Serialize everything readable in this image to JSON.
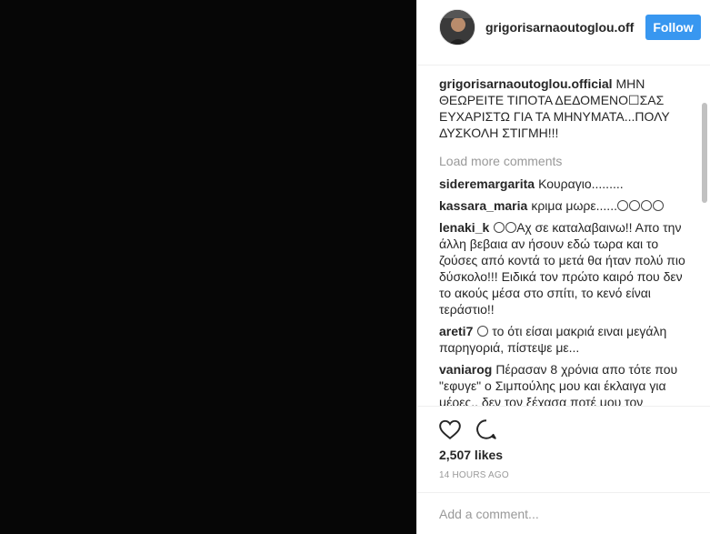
{
  "post": {
    "username": "grigorisarnaoutoglou.official",
    "username_short": "grigorisarnaoutoglou.off",
    "follow_label": "Follow",
    "caption": "ΜΗΝ ΘΕΩΡΕΙΤΕ ΤΙΠΟΤΑ ΔΕΔΟΜΕΝΟ☐ΣΑΣ ΕΥΧΑΡΙΣΤΩ ΓΙΑ ΤΑ ΜΗΝΥΜΑΤΑ...ΠΟΛΥ ΔΥΣΚΟΛΗ ΣΤΙΓΜΗ!!!",
    "load_more": "Load more comments",
    "likes": "2,507 likes",
    "time": "14 HOURS AGO",
    "add_comment_placeholder": "Add a comment..."
  },
  "comments": [
    {
      "user": "sideremargarita",
      "text": "Κουραγιο........."
    },
    {
      "user": "kassara_maria",
      "text": "κριμα μωρε......",
      "emoji_count": 4
    },
    {
      "user": "lenaki_k",
      "text": "Αχ σε καταλαβαινω!! Απο την άλλη βεβαια αν ήσουν εδώ τωρα και το ζούσες από κοντά το μετά θα ήταν πολύ πιο δύσκολο!!! Ειδικά τον πρώτο καιρό που δεν το ακούς μέσα στο σπίτι, το κενό είναι τεράστιο!!",
      "emoji_prefix": 2
    },
    {
      "user": "areti7",
      "text": "το ότι είσαι μακριά ειναι μεγάλη παρηγοριά, πίστεψε με...",
      "emoji_prefix": 1
    },
    {
      "user": "vaniarog",
      "text": "Πέρασαν 8 χρόνια απο τότε που \"εφυγε\" ο Σιμπούλης μου και έκλαιγα για μέρες.. δεν τον ξέχασα ποτέ μου τον"
    }
  ],
  "icons": {
    "like": "heart-icon",
    "comment": "comment-icon"
  },
  "colors": {
    "follow": "#3897f0",
    "media_bg": "#060606"
  }
}
